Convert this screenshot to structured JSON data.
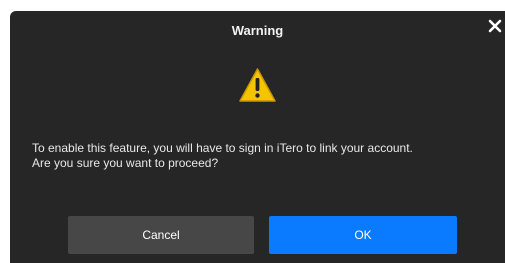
{
  "dialog": {
    "title": "Warning",
    "close_icon": "close-icon",
    "warning_icon": "warning-triangle-icon",
    "message_line1": "To enable this feature, you will have to sign in iTero to link your account.",
    "message_line2": "Are you sure you want to proceed?",
    "cancel_label": "Cancel",
    "ok_label": "OK"
  },
  "colors": {
    "background": "#262626",
    "primary_button": "#0a7bff",
    "secondary_button": "#474747",
    "warning_fill": "#f5c400"
  }
}
